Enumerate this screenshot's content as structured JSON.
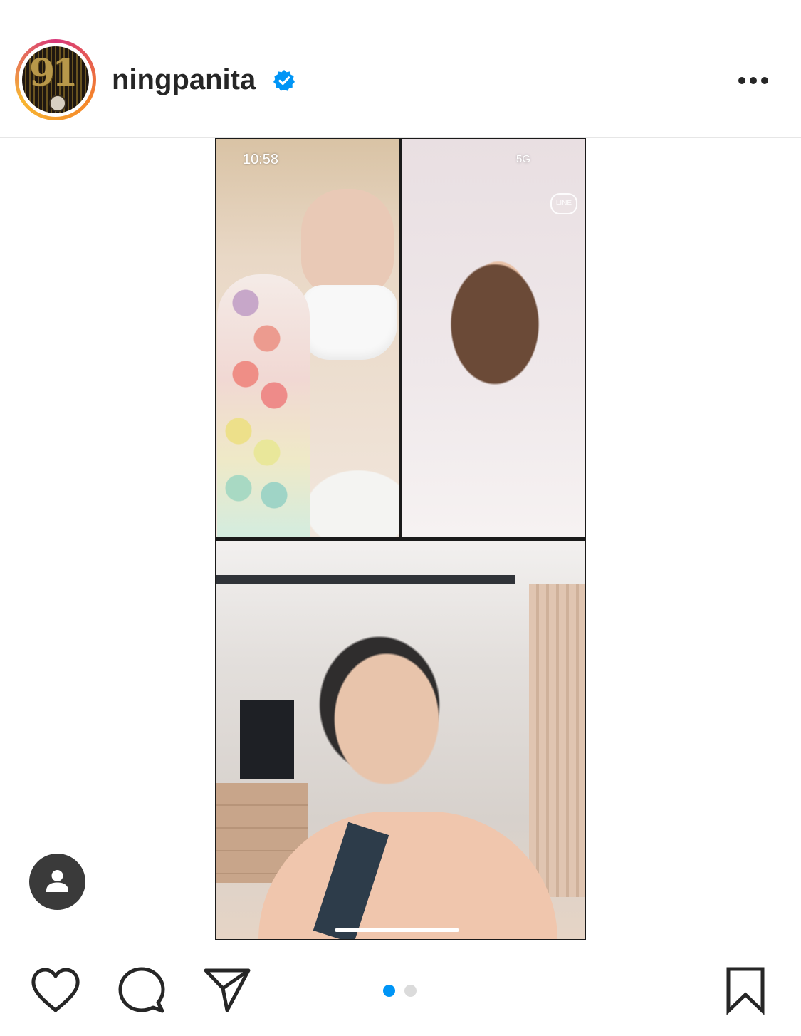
{
  "header": {
    "username": "ningpanita",
    "avatar_text": "91",
    "verified": true,
    "icons": {
      "verified": "verified-badge-icon",
      "more": "more-options-icon"
    }
  },
  "post": {
    "media_status": {
      "time": "10:58",
      "network": "5G",
      "app_badge": "LINE"
    },
    "carousel": {
      "current_index": 1,
      "total": 2
    }
  },
  "actions": {
    "icons": [
      "heart-icon",
      "comment-icon",
      "send-icon",
      "bookmark-icon"
    ]
  },
  "colors": {
    "accent_blue": "#0095f6",
    "dot_inactive": "#dbdbdb",
    "text": "#262626",
    "tag_button": "#3a3a3a"
  }
}
